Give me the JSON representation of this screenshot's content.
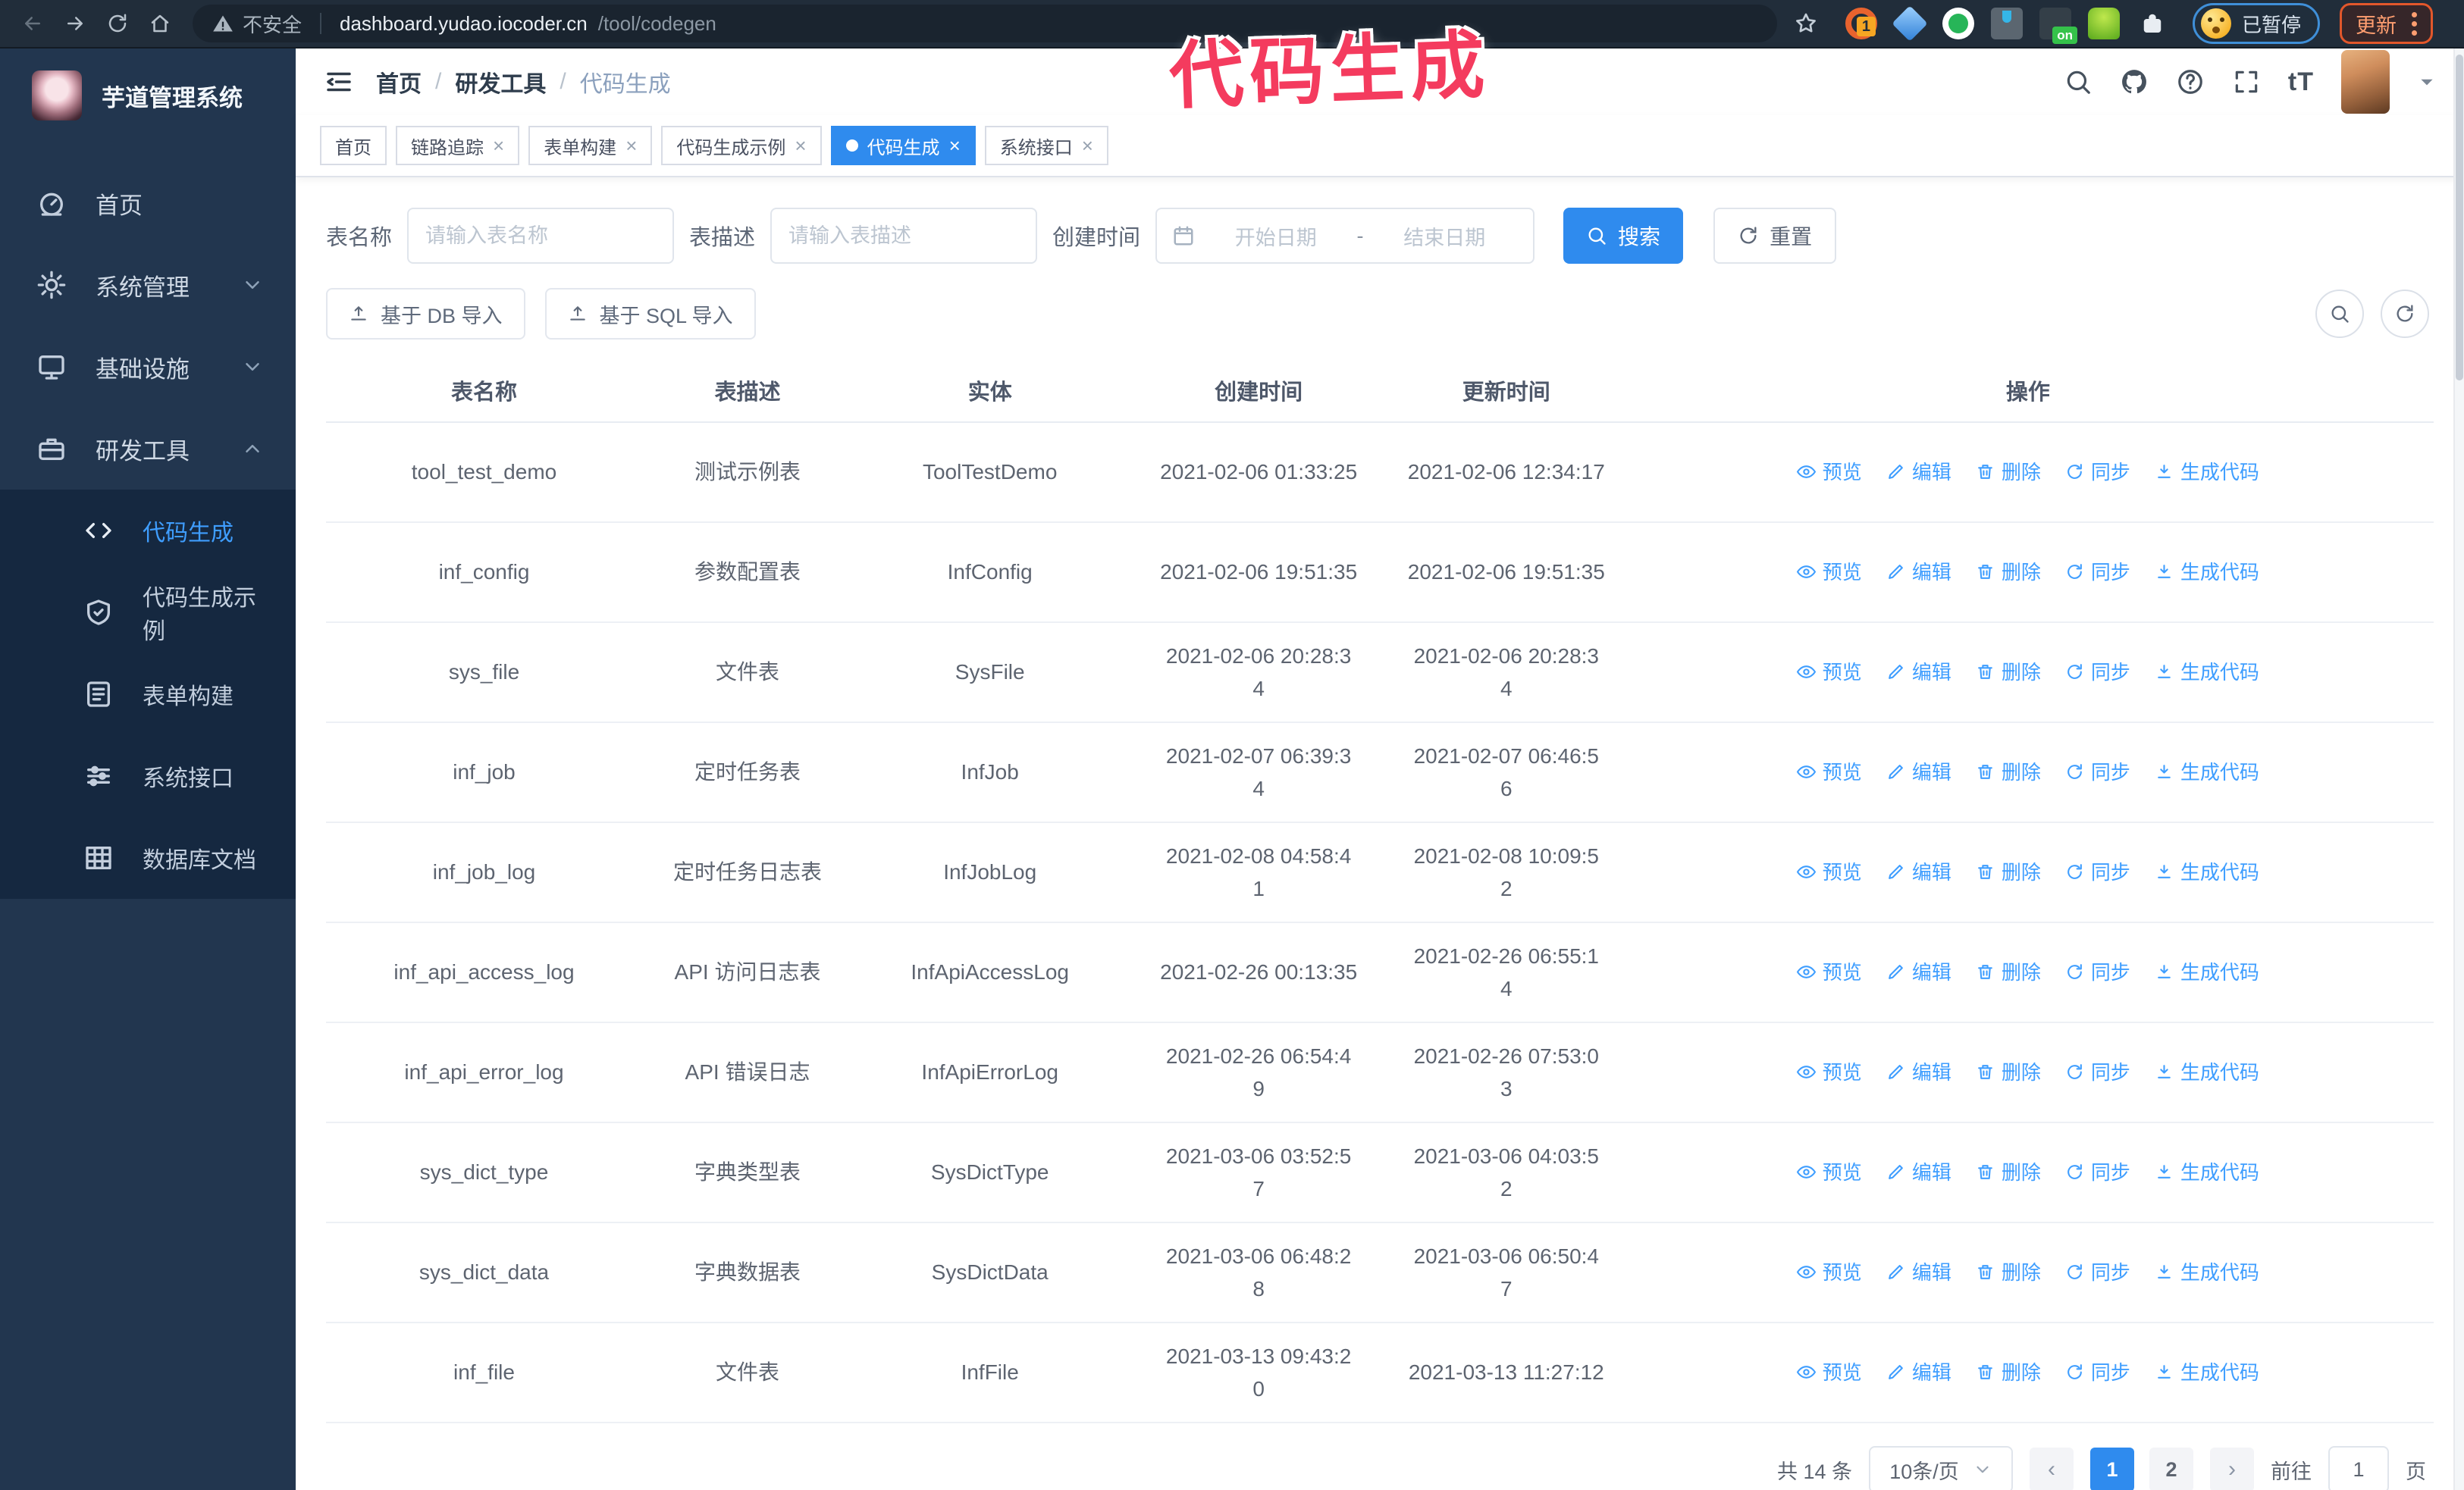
{
  "colors": {
    "primary": "#2f8bee",
    "link": "#3f9eff",
    "annotation": "#f43b5e",
    "sidebar_bg": "#22364f",
    "submenu_bg": "#152840",
    "browser_bg": "#212d3a"
  },
  "browser": {
    "security_label": "不安全",
    "url_host": "dashboard.yudao.iocoder.cn",
    "url_path": "/tool/codegen",
    "extension_badge": "1",
    "extension_on_badge": "on",
    "paused_badge": "已暂停",
    "update_label": "更新"
  },
  "annotation": {
    "text": "代码生成"
  },
  "sidebar": {
    "title": "芋道管理系统",
    "menu": [
      {
        "key": "home",
        "icon": "dashboard",
        "label": "首页",
        "chevron": null
      },
      {
        "key": "system",
        "icon": "gear",
        "label": "系统管理",
        "chevron": "down"
      },
      {
        "key": "infra",
        "icon": "monitor",
        "label": "基础设施",
        "chevron": "down"
      },
      {
        "key": "devtools",
        "icon": "toolbox",
        "label": "研发工具",
        "chevron": "up"
      }
    ],
    "submenu": [
      {
        "key": "codegen",
        "icon": "code",
        "label": "代码生成",
        "active": true
      },
      {
        "key": "codegen-demo",
        "icon": "shield-check",
        "label": "代码生成示例",
        "active": false
      },
      {
        "key": "form-builder",
        "icon": "form",
        "label": "表单构建",
        "active": false
      },
      {
        "key": "system-api",
        "icon": "sliders",
        "label": "系统接口",
        "active": false
      },
      {
        "key": "db-doc",
        "icon": "database",
        "label": "数据库文档",
        "active": false
      }
    ]
  },
  "breadcrumb": [
    "首页",
    "研发工具",
    "代码生成"
  ],
  "tabs": [
    {
      "label": "首页",
      "closable": false,
      "active": false
    },
    {
      "label": "链路追踪",
      "closable": true,
      "active": false
    },
    {
      "label": "表单构建",
      "closable": true,
      "active": false
    },
    {
      "label": "代码生成示例",
      "closable": true,
      "active": false
    },
    {
      "label": "代码生成",
      "closable": true,
      "active": true
    },
    {
      "label": "系统接口",
      "closable": true,
      "active": false
    }
  ],
  "filters": {
    "table_name_label": "表名称",
    "table_name_placeholder": "请输入表名称",
    "table_desc_label": "表描述",
    "table_desc_placeholder": "请输入表描述",
    "create_time_label": "创建时间",
    "date_start_placeholder": "开始日期",
    "date_separator": "-",
    "date_end_placeholder": "结束日期",
    "search_label": "搜索",
    "reset_label": "重置"
  },
  "toolbar": {
    "import_db_label": "基于 DB 导入",
    "import_sql_label": "基于 SQL 导入"
  },
  "table": {
    "columns": [
      "表名称",
      "表描述",
      "实体",
      "创建时间",
      "更新时间",
      "操作"
    ],
    "actions": [
      "预览",
      "编辑",
      "删除",
      "同步",
      "生成代码"
    ],
    "rows": [
      {
        "name": "tool_test_demo",
        "desc": "测试示例表",
        "entity": "ToolTestDemo",
        "created": "2021-02-06 01:33:25",
        "updated": "2021-02-06 12:34:17"
      },
      {
        "name": "inf_config",
        "desc": "参数配置表",
        "entity": "InfConfig",
        "created": "2021-02-06 19:51:35",
        "updated": "2021-02-06 19:51:35"
      },
      {
        "name": "sys_file",
        "desc": "文件表",
        "entity": "SysFile",
        "created": "2021-02-06 20:28:3\n4",
        "updated": "2021-02-06 20:28:3\n4"
      },
      {
        "name": "inf_job",
        "desc": "定时任务表",
        "entity": "InfJob",
        "created": "2021-02-07 06:39:3\n4",
        "updated": "2021-02-07 06:46:5\n6"
      },
      {
        "name": "inf_job_log",
        "desc": "定时任务日志表",
        "entity": "InfJobLog",
        "created": "2021-02-08 04:58:4\n1",
        "updated": "2021-02-08 10:09:5\n2"
      },
      {
        "name": "inf_api_access_log",
        "desc": "API 访问日志表",
        "entity": "InfApiAccessLog",
        "created": "2021-02-26 00:13:35",
        "updated": "2021-02-26 06:55:1\n4"
      },
      {
        "name": "inf_api_error_log",
        "desc": "API 错误日志",
        "entity": "InfApiErrorLog",
        "created": "2021-02-26 06:54:4\n9",
        "updated": "2021-02-26 07:53:0\n3"
      },
      {
        "name": "sys_dict_type",
        "desc": "字典类型表",
        "entity": "SysDictType",
        "created": "2021-03-06 03:52:5\n7",
        "updated": "2021-03-06 04:03:5\n2"
      },
      {
        "name": "sys_dict_data",
        "desc": "字典数据表",
        "entity": "SysDictData",
        "created": "2021-03-06 06:48:2\n8",
        "updated": "2021-03-06 06:50:4\n7"
      },
      {
        "name": "inf_file",
        "desc": "文件表",
        "entity": "InfFile",
        "created": "2021-03-13 09:43:2\n0",
        "updated": "2021-03-13 11:27:12"
      }
    ]
  },
  "pagination": {
    "total": "共 14 条",
    "page_size": "10条/页",
    "pages": [
      "1",
      "2"
    ],
    "active_page": "1",
    "goto_label": "前往",
    "goto_value": "1",
    "goto_suffix": "页"
  }
}
